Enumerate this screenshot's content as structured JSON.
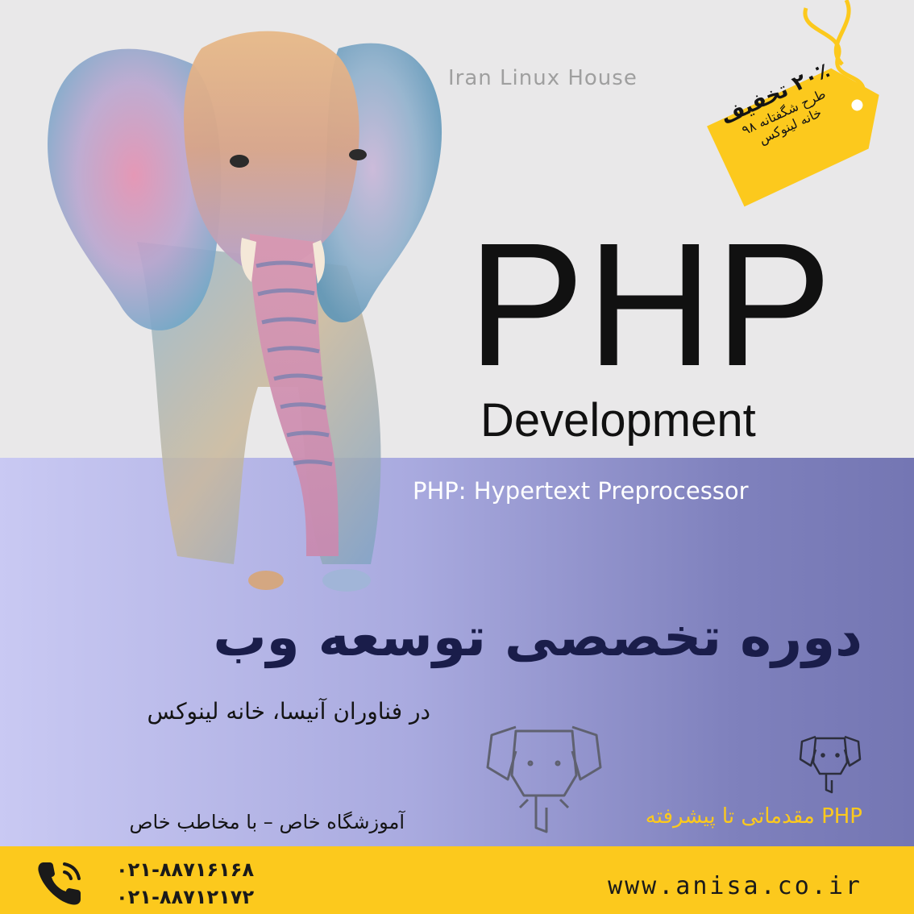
{
  "watermark": "Iran Linux House",
  "heading": {
    "php": "PHP",
    "development": "Development",
    "full_name": "PHP: Hypertext Preprocessor"
  },
  "discount_tag": {
    "line1": "۲۰٪ تخفیف",
    "line2": "طرح شگفتانه ۹۸",
    "line3": "خانه لینوکس"
  },
  "course": {
    "title": "دوره تخصصی توسعه وب",
    "subtitle": "در فناوران آنیسا، خانه لینوکس",
    "school": "آموزشگاه خاص – با مخاطب خاص",
    "level": "PHP مقدماتی تا پیشرفته"
  },
  "contact": {
    "phones": [
      "۰۲۱-۸۸۷۱۶۱۶۸",
      "۰۲۱-۸۸۷۱۲۱۷۲"
    ],
    "website": "www.anisa.co.ir"
  },
  "icons": [
    "phone-icon",
    "elephant-outline-icon",
    "price-tag-icon"
  ],
  "colors": {
    "band": "#8e90cc",
    "footer": "#fcc91d",
    "title": "#1a1d4a",
    "accent": "#fcc91d"
  }
}
